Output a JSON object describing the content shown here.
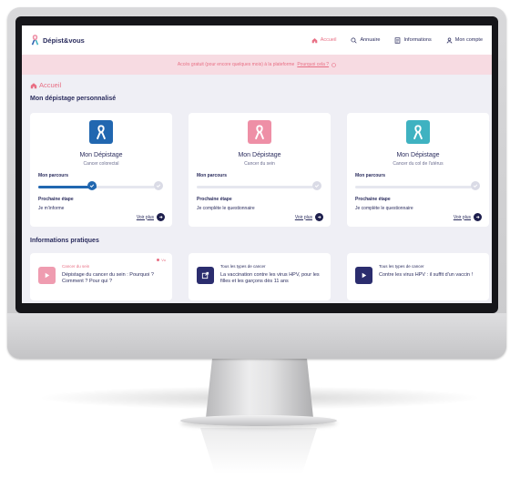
{
  "app": {
    "logo_text": "Dépist&vous"
  },
  "nav": {
    "items": [
      {
        "label": "Accueil",
        "icon": "home-icon"
      },
      {
        "label": "Annuaire",
        "icon": "search-icon"
      },
      {
        "label": "Informations",
        "icon": "document-icon"
      },
      {
        "label": "Mon compte",
        "icon": "user-icon"
      }
    ]
  },
  "banner": {
    "text": "Accès gratuit (pour encore quelques mois) à la plateforme",
    "link": "Pourquoi cela ?"
  },
  "breadcrumb": {
    "label": "Accueil"
  },
  "screening": {
    "section_title": "Mon dépistage personnalisé",
    "cards": [
      {
        "title": "Mon Dépistage",
        "subtitle": "Cancer colorectal",
        "progress_label": "Mon parcours",
        "progress": 0.5,
        "next_label": "Prochaine étape",
        "next_value": "Je m'informe",
        "more_label": "Voir plus",
        "color": "#2167b0"
      },
      {
        "title": "Mon Dépistage",
        "subtitle": "Cancer du sein",
        "progress_label": "Mon parcours",
        "progress": 0.0,
        "next_label": "Prochaine étape",
        "next_value": "Je complète le questionnaire",
        "more_label": "Voir plus",
        "color": "#ee8fa6"
      },
      {
        "title": "Mon Dépistage",
        "subtitle": "Cancer du col de l'utérus",
        "progress_label": "Mon parcours",
        "progress": 0.0,
        "next_label": "Prochaine étape",
        "next_value": "Je complète le questionnaire",
        "more_label": "Voir plus",
        "color": "#3fb2c1"
      }
    ]
  },
  "info": {
    "section_title": "Informations pratiques",
    "items": [
      {
        "category": "Cancer du sein",
        "title": "Dépistage du cancer du sein : Pourquoi ? Comment ? Pour qui ?",
        "tag": "Vu",
        "icon": "play-icon",
        "icon_bg": "#ef9cb0",
        "category_color": "#e86f84"
      },
      {
        "category": "Tous les types de cancer",
        "title": "La vaccination contre les virus HPV, pour les filles et les garçons dès 11 ans",
        "tag": "",
        "icon": "external-link-icon",
        "icon_bg": "#2b2d6e",
        "category_color": "#2b2d5e"
      },
      {
        "category": "Tous les types de cancer",
        "title": "Contre les virus HPV : il suffit d'un vaccin !",
        "tag": "",
        "icon": "play-icon",
        "icon_bg": "#2b2d6e",
        "category_color": "#2b2d5e"
      }
    ]
  }
}
